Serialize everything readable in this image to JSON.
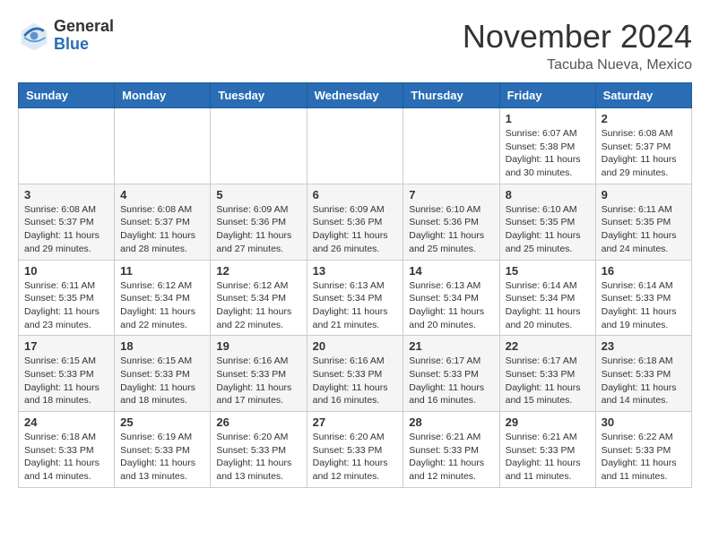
{
  "header": {
    "logo_general": "General",
    "logo_blue": "Blue",
    "month_title": "November 2024",
    "location": "Tacuba Nueva, Mexico"
  },
  "weekdays": [
    "Sunday",
    "Monday",
    "Tuesday",
    "Wednesday",
    "Thursday",
    "Friday",
    "Saturday"
  ],
  "weeks": [
    [
      {
        "day": "",
        "info": ""
      },
      {
        "day": "",
        "info": ""
      },
      {
        "day": "",
        "info": ""
      },
      {
        "day": "",
        "info": ""
      },
      {
        "day": "",
        "info": ""
      },
      {
        "day": "1",
        "info": "Sunrise: 6:07 AM\nSunset: 5:38 PM\nDaylight: 11 hours and 30 minutes."
      },
      {
        "day": "2",
        "info": "Sunrise: 6:08 AM\nSunset: 5:37 PM\nDaylight: 11 hours and 29 minutes."
      }
    ],
    [
      {
        "day": "3",
        "info": "Sunrise: 6:08 AM\nSunset: 5:37 PM\nDaylight: 11 hours and 29 minutes."
      },
      {
        "day": "4",
        "info": "Sunrise: 6:08 AM\nSunset: 5:37 PM\nDaylight: 11 hours and 28 minutes."
      },
      {
        "day": "5",
        "info": "Sunrise: 6:09 AM\nSunset: 5:36 PM\nDaylight: 11 hours and 27 minutes."
      },
      {
        "day": "6",
        "info": "Sunrise: 6:09 AM\nSunset: 5:36 PM\nDaylight: 11 hours and 26 minutes."
      },
      {
        "day": "7",
        "info": "Sunrise: 6:10 AM\nSunset: 5:36 PM\nDaylight: 11 hours and 25 minutes."
      },
      {
        "day": "8",
        "info": "Sunrise: 6:10 AM\nSunset: 5:35 PM\nDaylight: 11 hours and 25 minutes."
      },
      {
        "day": "9",
        "info": "Sunrise: 6:11 AM\nSunset: 5:35 PM\nDaylight: 11 hours and 24 minutes."
      }
    ],
    [
      {
        "day": "10",
        "info": "Sunrise: 6:11 AM\nSunset: 5:35 PM\nDaylight: 11 hours and 23 minutes."
      },
      {
        "day": "11",
        "info": "Sunrise: 6:12 AM\nSunset: 5:34 PM\nDaylight: 11 hours and 22 minutes."
      },
      {
        "day": "12",
        "info": "Sunrise: 6:12 AM\nSunset: 5:34 PM\nDaylight: 11 hours and 22 minutes."
      },
      {
        "day": "13",
        "info": "Sunrise: 6:13 AM\nSunset: 5:34 PM\nDaylight: 11 hours and 21 minutes."
      },
      {
        "day": "14",
        "info": "Sunrise: 6:13 AM\nSunset: 5:34 PM\nDaylight: 11 hours and 20 minutes."
      },
      {
        "day": "15",
        "info": "Sunrise: 6:14 AM\nSunset: 5:34 PM\nDaylight: 11 hours and 20 minutes."
      },
      {
        "day": "16",
        "info": "Sunrise: 6:14 AM\nSunset: 5:33 PM\nDaylight: 11 hours and 19 minutes."
      }
    ],
    [
      {
        "day": "17",
        "info": "Sunrise: 6:15 AM\nSunset: 5:33 PM\nDaylight: 11 hours and 18 minutes."
      },
      {
        "day": "18",
        "info": "Sunrise: 6:15 AM\nSunset: 5:33 PM\nDaylight: 11 hours and 18 minutes."
      },
      {
        "day": "19",
        "info": "Sunrise: 6:16 AM\nSunset: 5:33 PM\nDaylight: 11 hours and 17 minutes."
      },
      {
        "day": "20",
        "info": "Sunrise: 6:16 AM\nSunset: 5:33 PM\nDaylight: 11 hours and 16 minutes."
      },
      {
        "day": "21",
        "info": "Sunrise: 6:17 AM\nSunset: 5:33 PM\nDaylight: 11 hours and 16 minutes."
      },
      {
        "day": "22",
        "info": "Sunrise: 6:17 AM\nSunset: 5:33 PM\nDaylight: 11 hours and 15 minutes."
      },
      {
        "day": "23",
        "info": "Sunrise: 6:18 AM\nSunset: 5:33 PM\nDaylight: 11 hours and 14 minutes."
      }
    ],
    [
      {
        "day": "24",
        "info": "Sunrise: 6:18 AM\nSunset: 5:33 PM\nDaylight: 11 hours and 14 minutes."
      },
      {
        "day": "25",
        "info": "Sunrise: 6:19 AM\nSunset: 5:33 PM\nDaylight: 11 hours and 13 minutes."
      },
      {
        "day": "26",
        "info": "Sunrise: 6:20 AM\nSunset: 5:33 PM\nDaylight: 11 hours and 13 minutes."
      },
      {
        "day": "27",
        "info": "Sunrise: 6:20 AM\nSunset: 5:33 PM\nDaylight: 11 hours and 12 minutes."
      },
      {
        "day": "28",
        "info": "Sunrise: 6:21 AM\nSunset: 5:33 PM\nDaylight: 11 hours and 12 minutes."
      },
      {
        "day": "29",
        "info": "Sunrise: 6:21 AM\nSunset: 5:33 PM\nDaylight: 11 hours and 11 minutes."
      },
      {
        "day": "30",
        "info": "Sunrise: 6:22 AM\nSunset: 5:33 PM\nDaylight: 11 hours and 11 minutes."
      }
    ]
  ]
}
